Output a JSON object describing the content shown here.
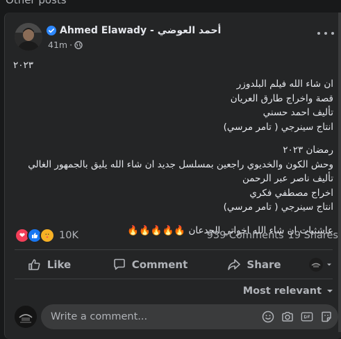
{
  "section": {
    "title": "Other posts"
  },
  "post": {
    "author": "Ahmed Elawady - أحمد العوضي",
    "time": "41m",
    "year_line": "٢٠٢٣",
    "block1": [
      "ان شاء الله فيلم البلدوزر",
      "قصة واخراج طارق العريان",
      "تأليف احمد حسني",
      "انتاج سينرجي ( تامر مرسي)"
    ],
    "block2": [
      "رمضان ٢٠٢٣",
      "وحش الكون والخديوي راجعين بمسلسل جديد ان شاء الله يليق بالجمهور الغالي",
      "تأليف ناصر عبر الرحمن",
      "اخراج مصطفي فكري",
      "انتاج سينرجي ( تامر مرسي)"
    ],
    "block3": "عاشثبات ان شاء الله اخواتي الجدعان 🔥🔥🔥🔥🔥",
    "reactions_count": "10K",
    "comments_count": "939 Comments",
    "shares_count": "19 Shares",
    "actions": {
      "like": "Like",
      "comment": "Comment",
      "share": "Share"
    },
    "sort_label": "Most relevant",
    "comment_placeholder": "Write a comment..."
  },
  "colors": {
    "background": "#18191a",
    "card": "#242526",
    "text_primary": "#e4e6eb",
    "text_secondary": "#b0b3b8",
    "verified_blue": "#2d88ff",
    "love_red": "#f33e58",
    "like_blue": "#1877f2",
    "care_yellow": "#f7b125"
  }
}
